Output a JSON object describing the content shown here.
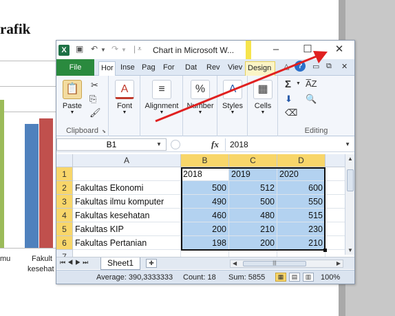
{
  "document": {
    "title_fragment": "rafik",
    "chart_labels": [
      "mu",
      "Fakult",
      "kesehat"
    ]
  },
  "window": {
    "title": "Chart in Microsoft W...",
    "minimize": "–",
    "maximize": "☐",
    "close": "✕"
  },
  "qat": {
    "save": "💾",
    "undo": "↶",
    "redo": "↷"
  },
  "tabs": {
    "file": "File",
    "home": "Hor",
    "insert": "Inse",
    "page_layout": "Pag",
    "formulas": "For",
    "data": "Dat",
    "review": "Rev",
    "view": "Viev",
    "design": "Design"
  },
  "ribbon": {
    "clipboard": {
      "paste": "Paste",
      "label": "Clipboard"
    },
    "font": {
      "label": "Font"
    },
    "alignment": {
      "label": "Alignment"
    },
    "number": {
      "label": "Number"
    },
    "styles": {
      "label": "Styles"
    },
    "cells": {
      "label": "Cells"
    },
    "editing": {
      "label": "Editing"
    }
  },
  "formula_bar": {
    "name_box": "B1",
    "fx": "fx",
    "value": "2018"
  },
  "sheet": {
    "columns": [
      "A",
      "B",
      "C",
      "D"
    ],
    "row_numbers": [
      "1",
      "2",
      "3",
      "4",
      "5",
      "6",
      "7"
    ],
    "header_row": [
      "",
      "2018",
      "2019",
      "2020"
    ],
    "rows": [
      {
        "label": "Fakultas Ekonomi",
        "values": [
          "500",
          "512",
          "600"
        ]
      },
      {
        "label": "Fakultas ilmu komputer",
        "values": [
          "490",
          "500",
          "550"
        ]
      },
      {
        "label": "Fakultas kesehatan",
        "values": [
          "460",
          "480",
          "515"
        ]
      },
      {
        "label": "Fakultas KIP",
        "values": [
          "200",
          "210",
          "230"
        ]
      },
      {
        "label": "Fakultas Pertanian",
        "values": [
          "198",
          "200",
          "210"
        ]
      }
    ]
  },
  "sheet_tabs": {
    "active": "Sheet1"
  },
  "status": {
    "average": "Average: 390,3333333",
    "count": "Count: 18",
    "sum": "Sum: 5855",
    "zoom": "100%"
  },
  "colors": {
    "file_tab": "#2a8a3e",
    "selection": "#b3d2f0",
    "selected_header": "#f8d66a",
    "annotation_arrow": "#e02020"
  }
}
